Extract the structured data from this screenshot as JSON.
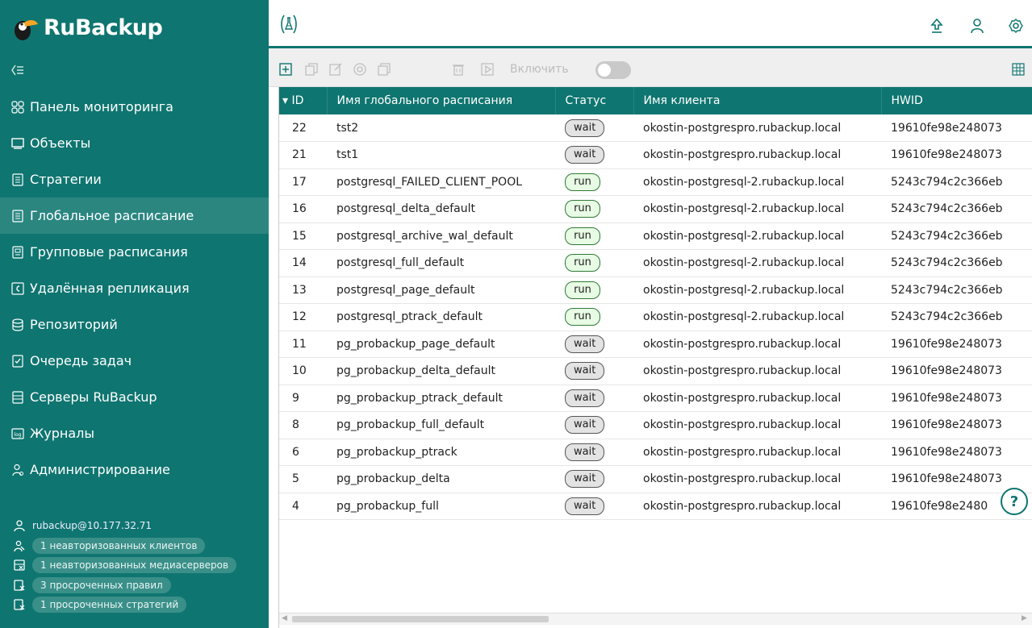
{
  "app": {
    "brand": "RuBackup"
  },
  "nav": [
    {
      "label": "Панель мониторинга",
      "icon": "dashboard-icon",
      "active": false
    },
    {
      "label": "Объекты",
      "icon": "monitor-icon",
      "active": false
    },
    {
      "label": "Стратегии",
      "icon": "strategy-icon",
      "active": false
    },
    {
      "label": "Глобальное расписание",
      "icon": "schedule-icon",
      "active": true
    },
    {
      "label": "Групповые расписания",
      "icon": "group-schedule-icon",
      "active": false
    },
    {
      "label": "Удалённая репликация",
      "icon": "replication-icon",
      "active": false
    },
    {
      "label": "Репозиторий",
      "icon": "database-icon",
      "active": false
    },
    {
      "label": "Очередь задач",
      "icon": "task-queue-icon",
      "active": false
    },
    {
      "label": "Серверы RuBackup",
      "icon": "server-icon",
      "active": false
    },
    {
      "label": "Журналы",
      "icon": "log-icon",
      "active": false
    },
    {
      "label": "Администрирование",
      "icon": "admin-icon",
      "active": false
    }
  ],
  "footer": {
    "user": "rubackup@10.177.32.71",
    "badges": [
      "1 неавторизованных клиентов",
      "1 неавторизованных медиасерверов",
      "3 просроченных правил",
      "1 просроченных стратегий"
    ]
  },
  "toolbar": {
    "enable_label": "Включить"
  },
  "table": {
    "sort_indicator": "▾",
    "columns": [
      "ID",
      "Имя глобального расписания",
      "Статус",
      "Имя клиента",
      "HWID"
    ],
    "rows": [
      {
        "id": "22",
        "name": "tst2",
        "status": "wait",
        "client": "okostin-postgrespro.rubackup.local",
        "hwid": "19610fe98e248073"
      },
      {
        "id": "21",
        "name": "tst1",
        "status": "wait",
        "client": "okostin-postgrespro.rubackup.local",
        "hwid": "19610fe98e248073"
      },
      {
        "id": "17",
        "name": "postgresql_FAILED_CLIENT_POOL",
        "status": "run",
        "client": "okostin-postgresql-2.rubackup.local",
        "hwid": "5243c794c2c366eb"
      },
      {
        "id": "16",
        "name": "postgresql_delta_default",
        "status": "run",
        "client": "okostin-postgresql-2.rubackup.local",
        "hwid": "5243c794c2c366eb"
      },
      {
        "id": "15",
        "name": "postgresql_archive_wal_default",
        "status": "run",
        "client": "okostin-postgresql-2.rubackup.local",
        "hwid": "5243c794c2c366eb"
      },
      {
        "id": "14",
        "name": "postgresql_full_default",
        "status": "run",
        "client": "okostin-postgresql-2.rubackup.local",
        "hwid": "5243c794c2c366eb"
      },
      {
        "id": "13",
        "name": "postgresql_page_default",
        "status": "run",
        "client": "okostin-postgresql-2.rubackup.local",
        "hwid": "5243c794c2c366eb"
      },
      {
        "id": "12",
        "name": "postgresql_ptrack_default",
        "status": "run",
        "client": "okostin-postgresql-2.rubackup.local",
        "hwid": "5243c794c2c366eb"
      },
      {
        "id": "11",
        "name": "pg_probackup_page_default",
        "status": "wait",
        "client": "okostin-postgrespro.rubackup.local",
        "hwid": "19610fe98e248073"
      },
      {
        "id": "10",
        "name": "pg_probackup_delta_default",
        "status": "wait",
        "client": "okostin-postgrespro.rubackup.local",
        "hwid": "19610fe98e248073"
      },
      {
        "id": "9",
        "name": "pg_probackup_ptrack_default",
        "status": "wait",
        "client": "okostin-postgrespro.rubackup.local",
        "hwid": "19610fe98e248073"
      },
      {
        "id": "8",
        "name": "pg_probackup_full_default",
        "status": "wait",
        "client": "okostin-postgrespro.rubackup.local",
        "hwid": "19610fe98e248073"
      },
      {
        "id": "6",
        "name": "pg_probackup_ptrack",
        "status": "wait",
        "client": "okostin-postgrespro.rubackup.local",
        "hwid": "19610fe98e248073"
      },
      {
        "id": "5",
        "name": "pg_probackup_delta",
        "status": "wait",
        "client": "okostin-postgrespro.rubackup.local",
        "hwid": "19610fe98e248073"
      },
      {
        "id": "4",
        "name": "pg_probackup_full",
        "status": "wait",
        "client": "okostin-postgrespro.rubackup.local",
        "hwid": "19610fe98e2480"
      }
    ]
  },
  "help": {
    "label": "?"
  },
  "colors": {
    "primary": "#0f7570",
    "sidebar_active": "#2b8680",
    "run_bg": "#e8fbe4",
    "wait_bg": "#e3e3e3"
  }
}
